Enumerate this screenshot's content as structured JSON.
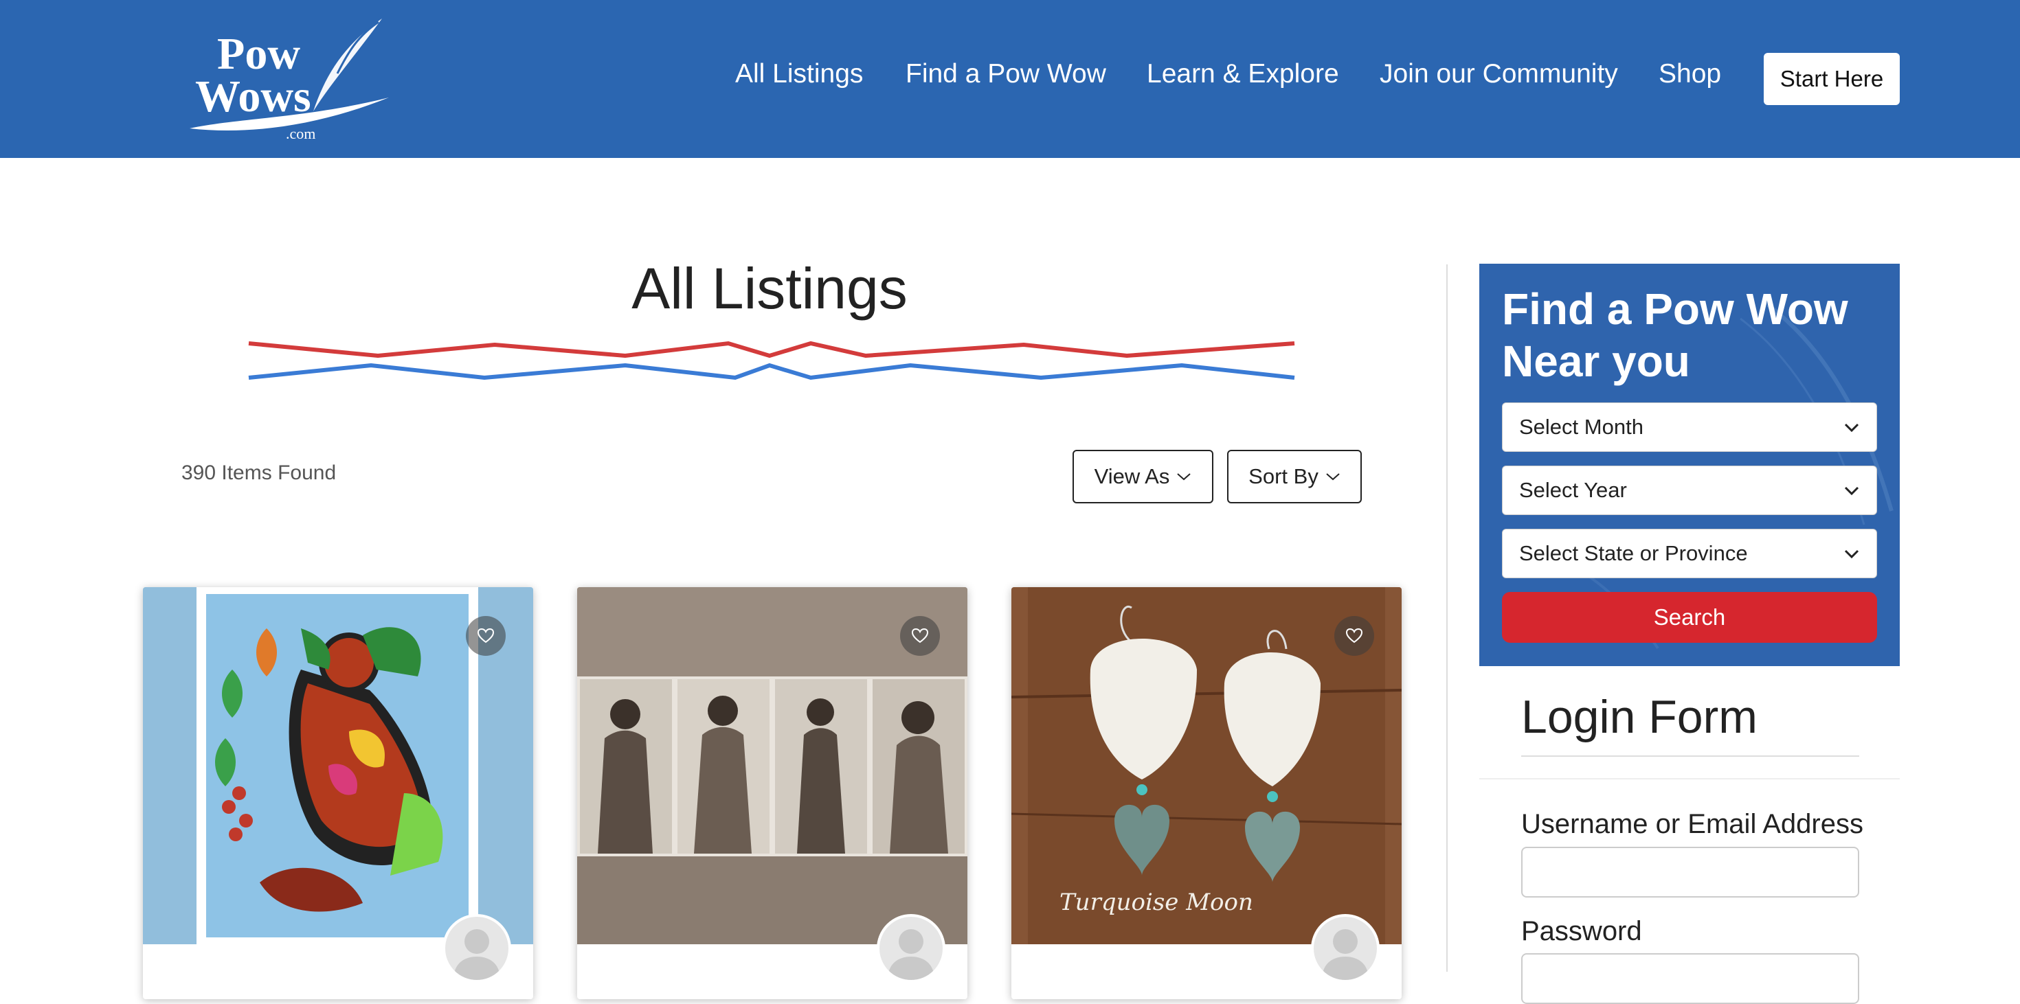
{
  "header": {
    "logo_text": "Pow Wows .com",
    "nav": [
      "All Listings",
      "Find a Pow Wow",
      "Learn & Explore",
      "Join our Community",
      "Shop"
    ],
    "start_label": "Start Here"
  },
  "main": {
    "title": "All Listings",
    "items_found": "390 Items Found",
    "view_as": "View As",
    "sort_by": "Sort By"
  },
  "cards": [
    {
      "image": "woodland-art-painting"
    },
    {
      "image": "native-women-photographs"
    },
    {
      "image": "shell-earrings",
      "watermark": "Turquoise Moon"
    }
  ],
  "finder": {
    "title": "Find a Pow Wow Near you",
    "month": "Select Month",
    "year": "Select Year",
    "region": "Select State or Province",
    "search": "Search"
  },
  "login": {
    "title": "Login Form",
    "username_label": "Username or Email Address",
    "password_label": "Password"
  },
  "colors": {
    "header_blue": "#2b66b1",
    "finder_blue": "#2f64ad",
    "search_red": "#d6262e",
    "line_red": "#d33b3b",
    "line_blue": "#3a7bd5"
  }
}
